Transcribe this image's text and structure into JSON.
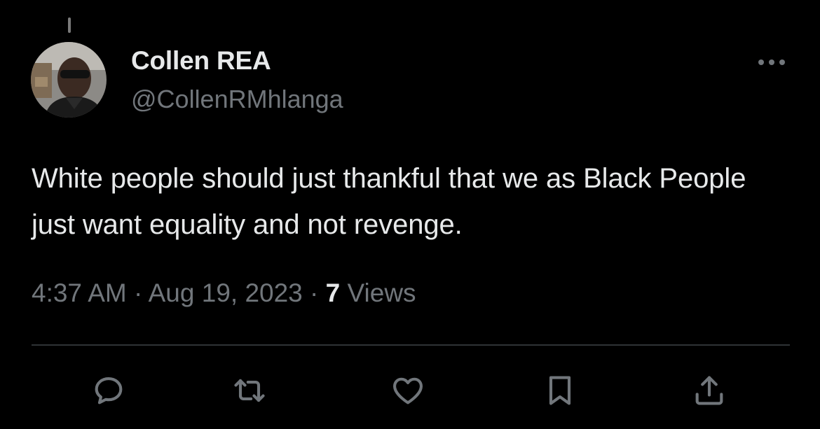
{
  "tweet": {
    "author": {
      "display_name": "Collen REA",
      "handle": "@CollenRMhlanga",
      "avatar": "profile-photo"
    },
    "text": "White people should just thankful that we as Black People just want equality and not revenge.",
    "meta": {
      "time": "4:37 AM",
      "separator": "·",
      "date": "Aug 19, 2023",
      "views_count": "7",
      "views_label": "Views"
    }
  },
  "actions": [
    {
      "name": "reply",
      "icon": "reply-icon"
    },
    {
      "name": "retweet",
      "icon": "retweet-icon"
    },
    {
      "name": "like",
      "icon": "heart-icon"
    },
    {
      "name": "bookmark",
      "icon": "bookmark-icon"
    },
    {
      "name": "share",
      "icon": "share-icon"
    }
  ],
  "colors": {
    "background": "#000000",
    "text_primary": "#e7e9ea",
    "text_secondary": "#71767b",
    "divider": "#2f3336"
  }
}
